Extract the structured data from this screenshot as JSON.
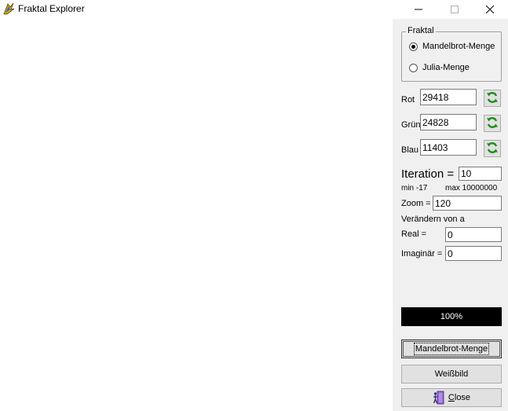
{
  "window": {
    "title": "Fraktal Explorer",
    "app_icon": "fractal-app-icon",
    "controls": [
      "minimize-icon",
      "maximize-icon",
      "close-icon"
    ]
  },
  "fraktal_group": {
    "legend": "Fraktal",
    "options": [
      {
        "label": "Mandelbrot-Menge",
        "checked": true
      },
      {
        "label": "Julia-Menge",
        "checked": false
      }
    ]
  },
  "colors": {
    "rot": {
      "label": "Rot",
      "value": "29418"
    },
    "gruen": {
      "label": "Grün",
      "value": "24828"
    },
    "blau": {
      "label": "Blau",
      "value": "11403"
    },
    "refresh_icon": "refresh-icon",
    "refresh_icon_color": "#1a8f1a"
  },
  "iteration": {
    "label": "Iteration =",
    "value": "10",
    "min_label": "min -17",
    "max_label": "max 10000000"
  },
  "zoom": {
    "label": "Zoom =",
    "value": "120"
  },
  "param_a": {
    "heading": "Verändern von a",
    "real_label": "Real =",
    "real_value": "0",
    "imag_label": "Imaginär =",
    "imag_value": "0"
  },
  "progress": {
    "text": "100%",
    "percent": 100
  },
  "buttons": {
    "mandelbrot": "Mandelbrot-Menge",
    "weissbild": "Weißbild",
    "close": "Close",
    "close_icon": "exit-door-icon"
  }
}
